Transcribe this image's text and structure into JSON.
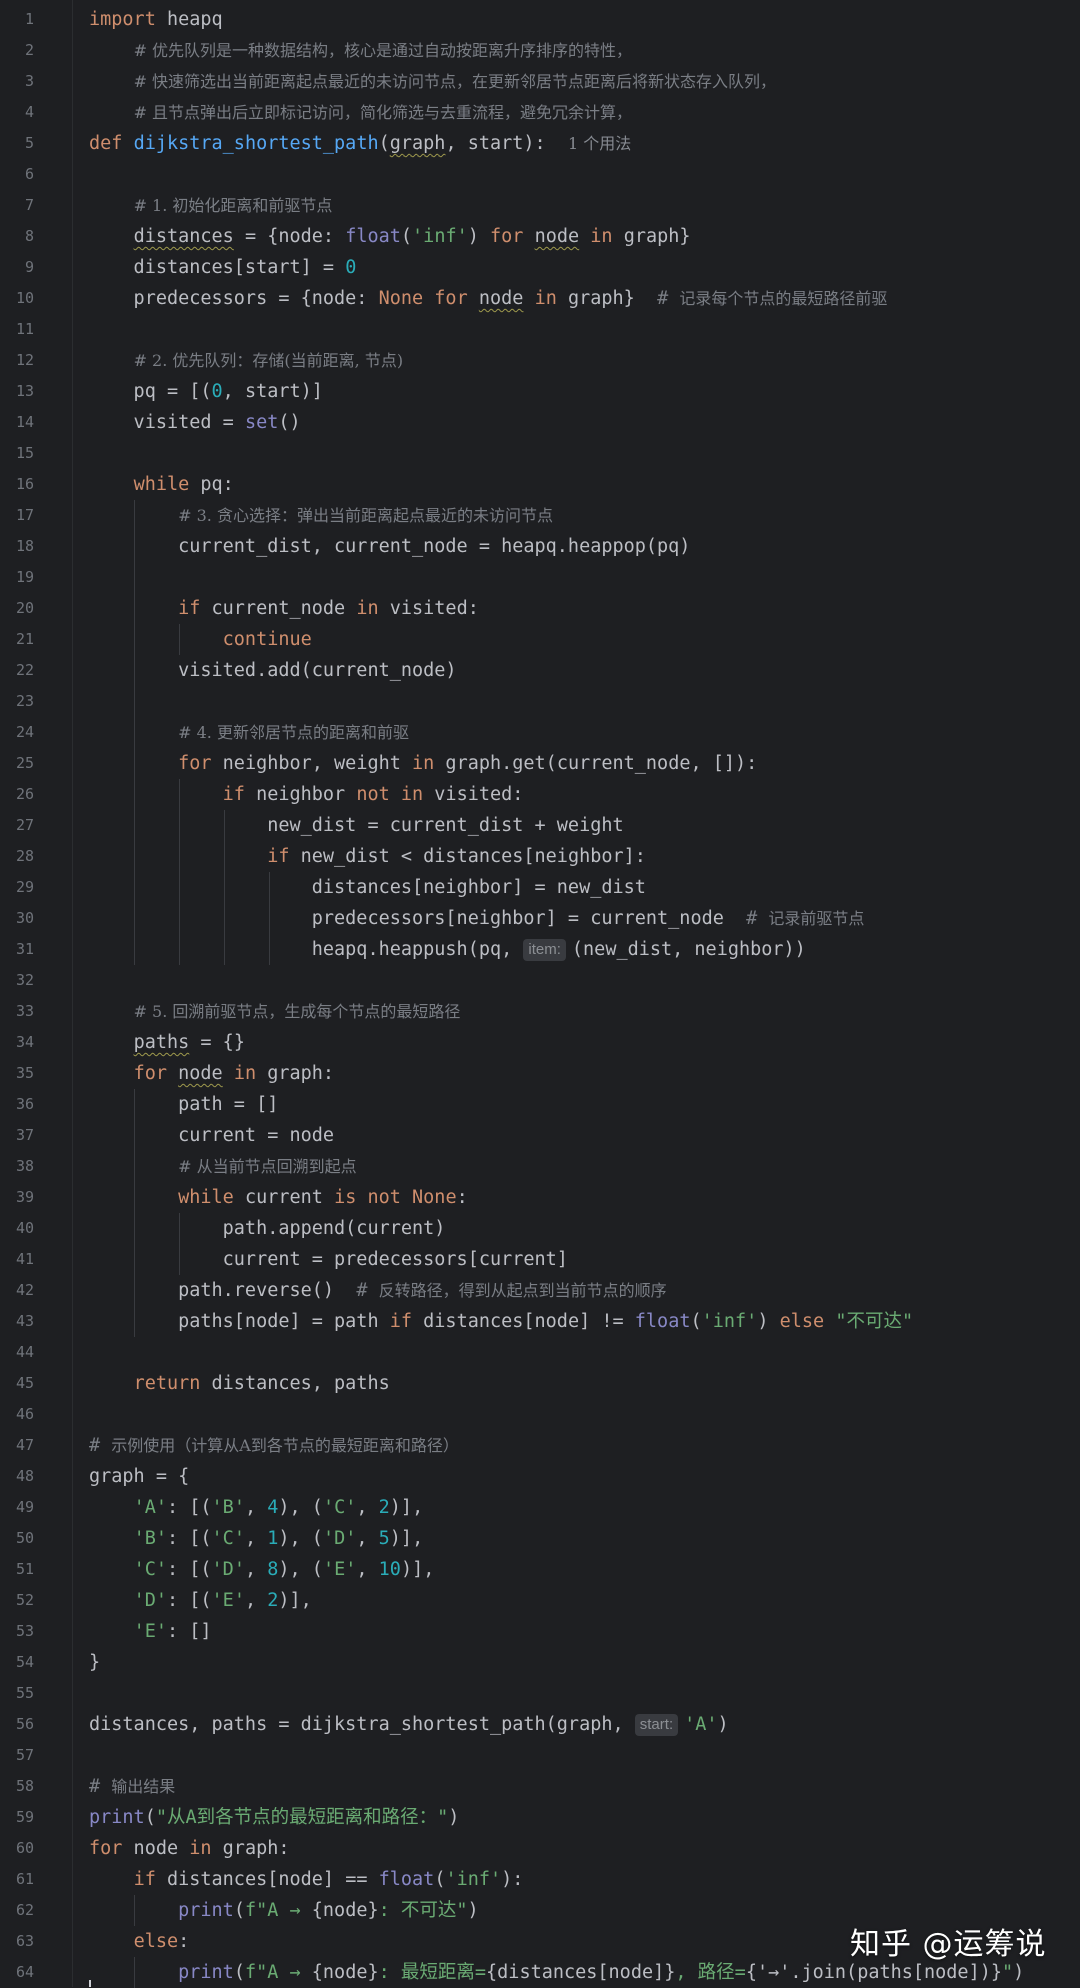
{
  "editor": {
    "language": "Python",
    "theme_colors": {
      "background": "#1e1f22",
      "keyword": "#cf8e6d",
      "function": "#56a8f5",
      "builtin": "#8888c6",
      "string": "#6aab73",
      "number": "#2aacb8",
      "comment": "#7a7e85",
      "line_number": "#6f737a"
    },
    "lines": [
      [
        {
          "t": "import",
          "c": "kw"
        },
        {
          "t": " heapq"
        }
      ],
      [
        {
          "t": "    "
        },
        {
          "t": "# 优先队列是一种数据结构，核心是通过自动按距离升序排序的特性，",
          "c": "cmt"
        }
      ],
      [
        {
          "t": "    "
        },
        {
          "t": "# 快速筛选出当前距离起点最近的未访问节点，在更新邻居节点距离后将新状态存入队列，",
          "c": "cmt"
        }
      ],
      [
        {
          "t": "    "
        },
        {
          "t": "# 且节点弹出后立即标记访问，简化筛选与去重流程，避免冗余计算，",
          "c": "cmt"
        }
      ],
      [
        {
          "t": "def",
          "c": "kw"
        },
        {
          "t": " "
        },
        {
          "t": "dijkstra_shortest_path",
          "c": "fn"
        },
        {
          "t": "("
        },
        {
          "t": "graph",
          "c": "wavy"
        },
        {
          "t": ", start):  "
        },
        {
          "t": "1 个用法",
          "c": "usage"
        }
      ],
      [],
      [
        {
          "t": "    "
        },
        {
          "t": "# 1. 初始化距离和前驱节点",
          "c": "cmt"
        }
      ],
      [
        {
          "t": "    "
        },
        {
          "t": "distances",
          "c": "wavy"
        },
        {
          "t": " = {node: "
        },
        {
          "t": "float",
          "c": "bi"
        },
        {
          "t": "("
        },
        {
          "t": "'inf'",
          "c": "str"
        },
        {
          "t": ") "
        },
        {
          "t": "for",
          "c": "kw"
        },
        {
          "t": " "
        },
        {
          "t": "node",
          "c": "wavy"
        },
        {
          "t": " "
        },
        {
          "t": "in",
          "c": "kw"
        },
        {
          "t": " graph}"
        }
      ],
      [
        {
          "t": "    distances[start] = "
        },
        {
          "t": "0",
          "c": "num"
        }
      ],
      [
        {
          "t": "    predecessors = {node: "
        },
        {
          "t": "None",
          "c": "kw"
        },
        {
          "t": " "
        },
        {
          "t": "for",
          "c": "kw"
        },
        {
          "t": " "
        },
        {
          "t": "node",
          "c": "wavy"
        },
        {
          "t": " "
        },
        {
          "t": "in",
          "c": "kw"
        },
        {
          "t": " graph}  "
        },
        {
          "t": "# ",
          "c": "cmt-mono"
        },
        {
          "t": "记录每个节点的最短路径前驱",
          "c": "cmt"
        }
      ],
      [],
      [
        {
          "t": "    "
        },
        {
          "t": "# 2. 优先队列：存储(当前距离, 节点)",
          "c": "cmt"
        }
      ],
      [
        {
          "t": "    pq = [("
        },
        {
          "t": "0",
          "c": "num"
        },
        {
          "t": ", start)]"
        }
      ],
      [
        {
          "t": "    visited = "
        },
        {
          "t": "set",
          "c": "bi"
        },
        {
          "t": "()"
        }
      ],
      [],
      [
        {
          "t": "    "
        },
        {
          "t": "while",
          "c": "kw"
        },
        {
          "t": " pq:"
        }
      ],
      [
        {
          "t": "        "
        },
        {
          "t": "# 3. 贪心选择：弹出当前距离起点最近的未访问节点",
          "c": "cmt"
        }
      ],
      [
        {
          "t": "        current_dist, current_node = heapq.heappop(pq)"
        }
      ],
      [],
      [
        {
          "t": "        "
        },
        {
          "t": "if",
          "c": "kw"
        },
        {
          "t": " current_node "
        },
        {
          "t": "in",
          "c": "kw"
        },
        {
          "t": " visited:"
        }
      ],
      [
        {
          "t": "            "
        },
        {
          "t": "continue",
          "c": "kw"
        }
      ],
      [
        {
          "t": "        visited.add(current_node)"
        }
      ],
      [],
      [
        {
          "t": "        "
        },
        {
          "t": "# 4. 更新邻居节点的距离和前驱",
          "c": "cmt"
        }
      ],
      [
        {
          "t": "        "
        },
        {
          "t": "for",
          "c": "kw"
        },
        {
          "t": " neighbor, weight "
        },
        {
          "t": "in",
          "c": "kw"
        },
        {
          "t": " graph.get(current_node, []):"
        }
      ],
      [
        {
          "t": "            "
        },
        {
          "t": "if",
          "c": "kw"
        },
        {
          "t": " neighbor "
        },
        {
          "t": "not in",
          "c": "kw"
        },
        {
          "t": " visited:"
        }
      ],
      [
        {
          "t": "                new_dist = current_dist + weight"
        }
      ],
      [
        {
          "t": "                "
        },
        {
          "t": "if",
          "c": "kw"
        },
        {
          "t": " new_dist < distances[neighbor]:"
        }
      ],
      [
        {
          "t": "                    distances[neighbor] = new_dist"
        }
      ],
      [
        {
          "t": "                    predecessors[neighbor] = current_node  "
        },
        {
          "t": "# ",
          "c": "cmt-mono"
        },
        {
          "t": "记录前驱节点",
          "c": "cmt"
        }
      ],
      [
        {
          "t": "                    heapq.heappush(pq, "
        },
        {
          "t": "item:",
          "c": "hint"
        },
        {
          "t": "(new_dist, neighbor))"
        }
      ],
      [],
      [
        {
          "t": "    "
        },
        {
          "t": "# 5. 回溯前驱节点，生成每个节点的最短路径",
          "c": "cmt"
        }
      ],
      [
        {
          "t": "    "
        },
        {
          "t": "paths",
          "c": "wavy"
        },
        {
          "t": " = {}"
        }
      ],
      [
        {
          "t": "    "
        },
        {
          "t": "for",
          "c": "kw"
        },
        {
          "t": " "
        },
        {
          "t": "node",
          "c": "wavy"
        },
        {
          "t": " "
        },
        {
          "t": "in",
          "c": "kw"
        },
        {
          "t": " graph:"
        }
      ],
      [
        {
          "t": "        path = []"
        }
      ],
      [
        {
          "t": "        current = node"
        }
      ],
      [
        {
          "t": "        "
        },
        {
          "t": "# 从当前节点回溯到起点",
          "c": "cmt"
        }
      ],
      [
        {
          "t": "        "
        },
        {
          "t": "while",
          "c": "kw"
        },
        {
          "t": " current "
        },
        {
          "t": "is not None",
          "c": "kw"
        },
        {
          "t": ":"
        }
      ],
      [
        {
          "t": "            path.append(current)"
        }
      ],
      [
        {
          "t": "            current = predecessors[current]"
        }
      ],
      [
        {
          "t": "        path.reverse()  "
        },
        {
          "t": "# ",
          "c": "cmt-mono"
        },
        {
          "t": "反转路径，得到从起点到当前节点的顺序",
          "c": "cmt"
        }
      ],
      [
        {
          "t": "        paths[node] = path "
        },
        {
          "t": "if",
          "c": "kw"
        },
        {
          "t": " distances[node] != "
        },
        {
          "t": "float",
          "c": "bi"
        },
        {
          "t": "("
        },
        {
          "t": "'inf'",
          "c": "str"
        },
        {
          "t": ") "
        },
        {
          "t": "else",
          "c": "kw"
        },
        {
          "t": " "
        },
        {
          "t": "\"不可达\"",
          "c": "str"
        }
      ],
      [],
      [
        {
          "t": "    "
        },
        {
          "t": "return",
          "c": "kw"
        },
        {
          "t": " distances, paths"
        }
      ],
      [],
      [
        {
          "t": "# ",
          "c": "cmt-mono"
        },
        {
          "t": "示例使用（计算从A到各节点的最短距离和路径）",
          "c": "cmt"
        }
      ],
      [
        {
          "t": "graph = {"
        }
      ],
      [
        {
          "t": "    "
        },
        {
          "t": "'A'",
          "c": "str"
        },
        {
          "t": ": [("
        },
        {
          "t": "'B'",
          "c": "str"
        },
        {
          "t": ", "
        },
        {
          "t": "4",
          "c": "num"
        },
        {
          "t": "), ("
        },
        {
          "t": "'C'",
          "c": "str"
        },
        {
          "t": ", "
        },
        {
          "t": "2",
          "c": "num"
        },
        {
          "t": ")],"
        }
      ],
      [
        {
          "t": "    "
        },
        {
          "t": "'B'",
          "c": "str"
        },
        {
          "t": ": [("
        },
        {
          "t": "'C'",
          "c": "str"
        },
        {
          "t": ", "
        },
        {
          "t": "1",
          "c": "num"
        },
        {
          "t": "), ("
        },
        {
          "t": "'D'",
          "c": "str"
        },
        {
          "t": ", "
        },
        {
          "t": "5",
          "c": "num"
        },
        {
          "t": ")],"
        }
      ],
      [
        {
          "t": "    "
        },
        {
          "t": "'C'",
          "c": "str"
        },
        {
          "t": ": [("
        },
        {
          "t": "'D'",
          "c": "str"
        },
        {
          "t": ", "
        },
        {
          "t": "8",
          "c": "num"
        },
        {
          "t": "), ("
        },
        {
          "t": "'E'",
          "c": "str"
        },
        {
          "t": ", "
        },
        {
          "t": "10",
          "c": "num"
        },
        {
          "t": ")],"
        }
      ],
      [
        {
          "t": "    "
        },
        {
          "t": "'D'",
          "c": "str"
        },
        {
          "t": ": [("
        },
        {
          "t": "'E'",
          "c": "str"
        },
        {
          "t": ", "
        },
        {
          "t": "2",
          "c": "num"
        },
        {
          "t": ")],"
        }
      ],
      [
        {
          "t": "    "
        },
        {
          "t": "'E'",
          "c": "str"
        },
        {
          "t": ": []"
        }
      ],
      [
        {
          "t": "}"
        }
      ],
      [],
      [
        {
          "t": "distances, paths = dijkstra_shortest_path(graph, "
        },
        {
          "t": "start:",
          "c": "hint"
        },
        {
          "t": "'A'",
          "c": "str"
        },
        {
          "t": ")"
        }
      ],
      [],
      [
        {
          "t": "# ",
          "c": "cmt-mono"
        },
        {
          "t": "输出结果",
          "c": "cmt"
        }
      ],
      [
        {
          "t": "print",
          "c": "bi"
        },
        {
          "t": "("
        },
        {
          "t": "\"从A到各节点的最短距离和路径：\"",
          "c": "str"
        },
        {
          "t": ")"
        }
      ],
      [
        {
          "t": "for",
          "c": "kw"
        },
        {
          "t": " node "
        },
        {
          "t": "in",
          "c": "kw"
        },
        {
          "t": " graph:"
        }
      ],
      [
        {
          "t": "    "
        },
        {
          "t": "if",
          "c": "kw"
        },
        {
          "t": " distances[node] == "
        },
        {
          "t": "float",
          "c": "bi"
        },
        {
          "t": "("
        },
        {
          "t": "'inf'",
          "c": "str"
        },
        {
          "t": "):"
        }
      ],
      [
        {
          "t": "        "
        },
        {
          "t": "print",
          "c": "bi"
        },
        {
          "t": "("
        },
        {
          "t": "f\"A → ",
          "c": "str"
        },
        {
          "t": "{node}"
        },
        {
          "t": ": 不可达\"",
          "c": "str"
        },
        {
          "t": ")"
        }
      ],
      [
        {
          "t": "    "
        },
        {
          "t": "else",
          "c": "kw"
        },
        {
          "t": ":"
        }
      ],
      [
        {
          "t": "        "
        },
        {
          "t": "print",
          "c": "bi"
        },
        {
          "t": "("
        },
        {
          "t": "f\"A → ",
          "c": "str"
        },
        {
          "t": "{node}"
        },
        {
          "t": ": 最短距离=",
          "c": "str"
        },
        {
          "t": "{distances[node]}"
        },
        {
          "t": ", 路径=",
          "c": "str"
        },
        {
          "t": "{'→'.join(paths[node])}"
        },
        {
          "t": "\"",
          "c": "str"
        },
        {
          "t": ")"
        }
      ]
    ]
  },
  "watermark": {
    "text": "知乎 @运筹说"
  }
}
